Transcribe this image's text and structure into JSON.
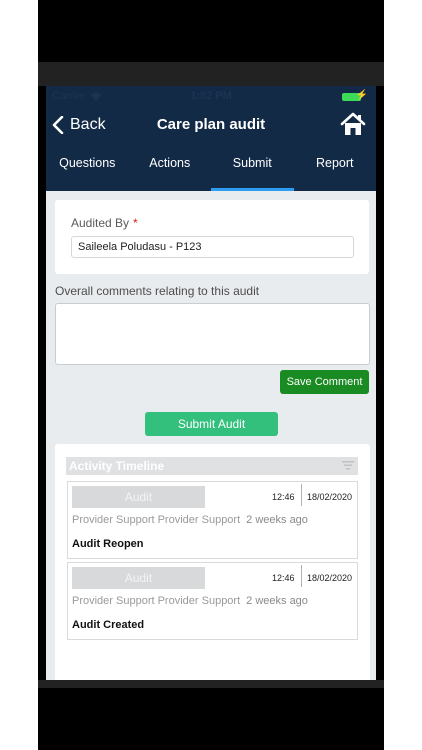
{
  "status_bar": {
    "carrier": "Carrier",
    "time": "1:52 PM"
  },
  "nav": {
    "back_label": "Back",
    "title": "Care plan audit",
    "home_icon": "home-icon"
  },
  "tabs": [
    {
      "label": "Questions",
      "active": false
    },
    {
      "label": "Actions",
      "active": false
    },
    {
      "label": "Submit",
      "active": true
    },
    {
      "label": "Report",
      "active": false
    }
  ],
  "audited_by": {
    "label": "Audited By",
    "required_mark": "*",
    "value": "Saileela Poludasu - P123"
  },
  "comments": {
    "label": "Overall comments relating to this audit",
    "value": ""
  },
  "buttons": {
    "save_comment": "Save Comment",
    "submit_audit": "Submit Audit"
  },
  "timeline": {
    "title": "Activity Timeline",
    "entries": [
      {
        "badge": "Audit",
        "time": "12:46",
        "date": "18/02/2020",
        "user": "Provider Support Provider Support",
        "ago": "2 weeks ago",
        "event": "Audit Reopen"
      },
      {
        "badge": "Audit",
        "time": "12:46",
        "date": "18/02/2020",
        "user": "Provider Support Provider Support",
        "ago": "2 weeks ago",
        "event": "Audit Created"
      }
    ]
  },
  "colors": {
    "nav_bg": "#132a47",
    "tab_underline": "#2e9cf0",
    "save_btn": "#1a8a23",
    "submit_btn": "#33c07d",
    "battery": "#3ddc58"
  }
}
